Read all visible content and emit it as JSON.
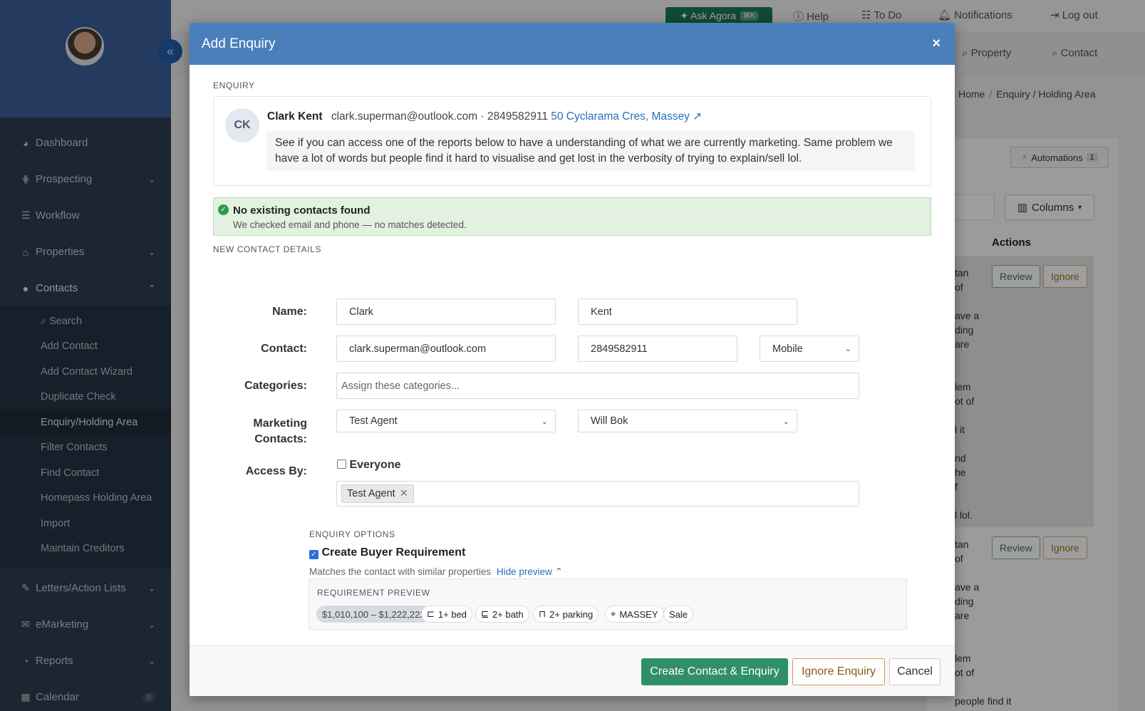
{
  "sidebar": {
    "collapse_icon": "«",
    "items": [
      {
        "label": "Dashboard",
        "icon": "◕"
      },
      {
        "label": "Prospecting",
        "icon": "⋕"
      },
      {
        "label": "Workflow",
        "icon": "☰"
      },
      {
        "label": "Properties",
        "icon": "⌂"
      },
      {
        "label": "Contacts",
        "icon": "👤"
      }
    ],
    "contacts_sub": [
      "Search",
      "Add Contact",
      "Add Contact Wizard",
      "Duplicate Check",
      "Enquiry/Holding Area",
      "Filter Contacts",
      "Find Contact",
      "Homepass Holding Area",
      "Import",
      "Maintain Creditors"
    ],
    "bottom_items": [
      {
        "label": "Letters/Action Lists",
        "icon": "✎"
      },
      {
        "label": "eMarketing",
        "icon": "✉"
      },
      {
        "label": "Reports",
        "icon": "◔"
      },
      {
        "label": "Calendar",
        "icon": "▦",
        "badge": "0"
      }
    ]
  },
  "topbar": {
    "ask": "✦ Ask Agora",
    "ask_kbd": "⌘K",
    "help": "Help",
    "todo": "To Do",
    "notifications": "Notifications",
    "logout": "Log out",
    "property": "Property",
    "contact": "Contact"
  },
  "breadcrumb": {
    "home": "Home",
    "current": "Enquiry / Holding Area"
  },
  "background": {
    "automations": "Automations",
    "automations_count": "1",
    "columns": "Columns",
    "actions": "Actions",
    "review": "Review",
    "ignore": "Ignore",
    "fragments1": [
      "tan",
      "of",
      "",
      "ave a",
      "ding",
      "are",
      "",
      "",
      "lem",
      "ot of",
      "",
      "l it",
      "",
      "nd",
      "he",
      "f",
      "",
      "l lol."
    ],
    "fragments2": [
      "tan",
      "of",
      "",
      "ave a",
      "ding",
      "are",
      "",
      "",
      "lem",
      "ot of",
      "",
      "people find it"
    ]
  },
  "modal": {
    "title": "Add Enquiry",
    "enquiry_label": "ENQUIRY",
    "initials": "CK",
    "name": "Clark Kent",
    "email_phone": "clark.superman@outlook.com · 2849582911",
    "address": "50 Cyclarama Cres, Massey",
    "message": "See if you can access one of the reports below to have a understanding of what we are currently marketing. Same problem we have a lot of words but people find it hard to visualise and get lost in the verbosity of trying to explain/sell lol.",
    "alert_title": "No existing contacts found",
    "alert_text": "We checked email and phone — no matches detected.",
    "details_label": "NEW CONTACT DETAILS",
    "labels": {
      "name": "Name:",
      "contact": "Contact:",
      "categories": "Categories:",
      "marketing": "Marketing Contacts:",
      "access": "Access By:"
    },
    "first_name": "Clark",
    "last_name": "Kent",
    "email": "clark.superman@outlook.com",
    "phone": "2849582911",
    "phone_type": "Mobile",
    "categories_placeholder": "Assign these categories...",
    "marketing_1": "Test Agent",
    "marketing_2": "Will Bok",
    "everyone": "Everyone",
    "access_tag": "Test Agent",
    "options_label": "ENQUIRY OPTIONS",
    "create_buyer": "Create Buyer Requirement",
    "matches_text": "Matches the contact with similar properties",
    "hide_preview": "Hide preview",
    "preview_label": "REQUIREMENT PREVIEW",
    "pills": {
      "price": "$1,010,100 – $1,222,222",
      "bed": "1+ bed",
      "bath": "2+ bath",
      "parking": "2+ parking",
      "suburb": "MASSEY",
      "type": "Sale"
    },
    "buttons": {
      "create": "Create Contact & Enquiry",
      "ignore": "Ignore Enquiry",
      "cancel": "Cancel"
    }
  }
}
